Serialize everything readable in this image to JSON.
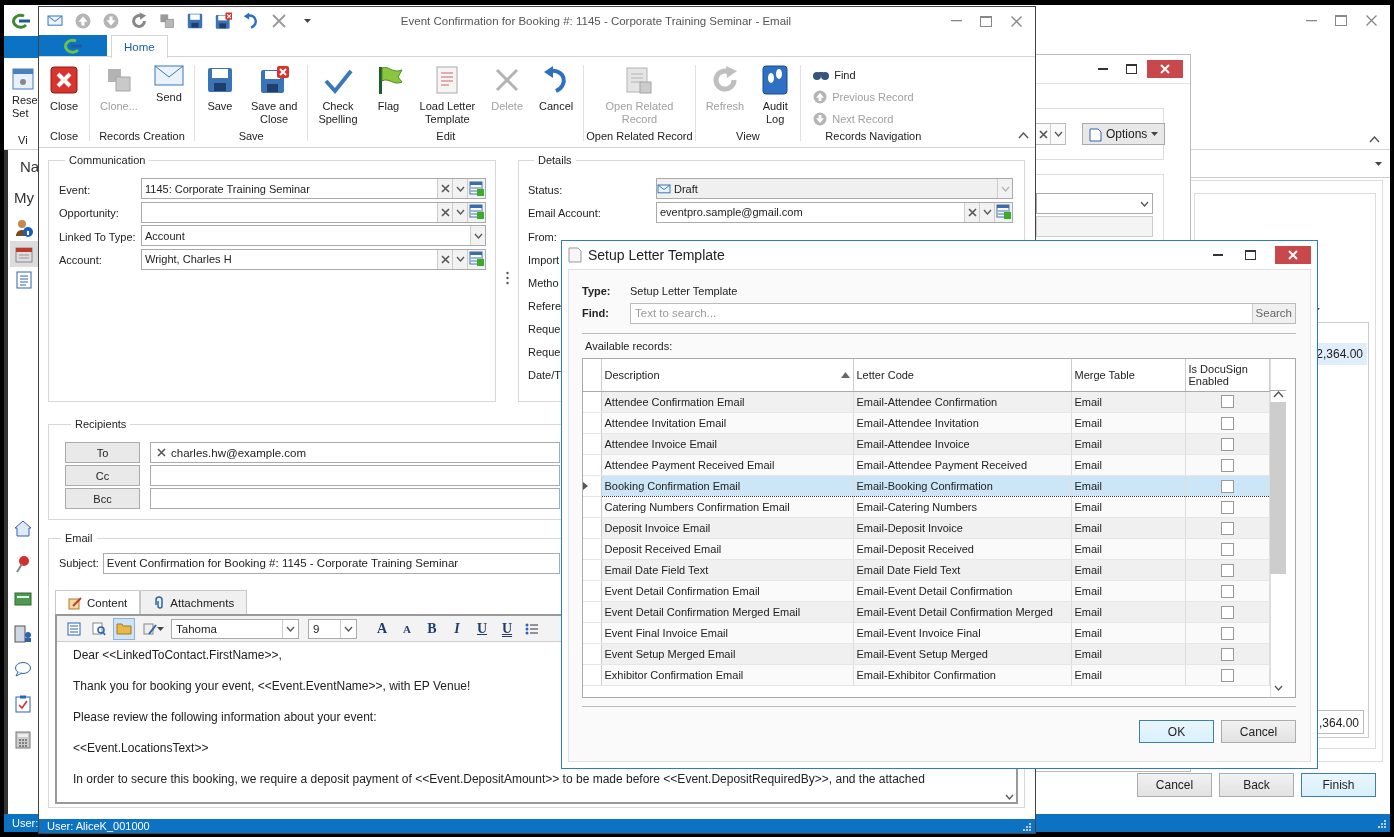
{
  "main_window": {
    "ribbon_button_lines": [
      "Rese",
      "Set"
    ],
    "ribbon_group": "Vi",
    "nav": {
      "title": "Na",
      "subtitle": "My",
      "icons": [
        {
          "selected": false
        },
        {
          "selected": true
        },
        {
          "selected": false
        }
      ]
    },
    "wizard": {
      "amount": "2,364.00",
      "total": ",364.00",
      "buttons": [
        {
          "label": "Cancel",
          "default": false
        },
        {
          "label": "Back",
          "default": false
        },
        {
          "label": "Finish",
          "default": true
        }
      ]
    },
    "status_bar": {
      "user": "User:"
    }
  },
  "options_window": {
    "options_button": "Options"
  },
  "email_window": {
    "title": "Event Confirmation for Booking #: 1145 - Corporate Training Seminar - Email",
    "tab": "Home",
    "ribbon": {
      "groups": [
        {
          "label": "Close",
          "buttons": [
            {
              "label": "Close",
              "disabled": false
            }
          ]
        },
        {
          "label": "Records Creation",
          "buttons": [
            {
              "label": "Clone...",
              "disabled": true
            },
            {
              "label": "Send",
              "disabled": false
            }
          ]
        },
        {
          "label": "Save",
          "buttons": [
            {
              "label": "Save",
              "disabled": false
            },
            {
              "label": "Save and\nClose",
              "disabled": false
            }
          ]
        },
        {
          "label": "Edit",
          "buttons": [
            {
              "label": "Check\nSpelling",
              "disabled": false
            },
            {
              "label": "Flag",
              "disabled": false
            },
            {
              "label": "Load Letter\nTemplate",
              "disabled": false
            },
            {
              "label": "Delete",
              "disabled": true
            },
            {
              "label": "Cancel",
              "disabled": false
            }
          ]
        },
        {
          "label": "Open Related Record",
          "buttons": [
            {
              "label": "Open Related\nRecord",
              "disabled": true
            }
          ]
        },
        {
          "label": "View",
          "buttons": [
            {
              "label": "Refresh",
              "disabled": true
            },
            {
              "label": "Audit\nLog",
              "disabled": false
            }
          ]
        },
        {
          "label": "Records Navigation",
          "small_buttons": [
            {
              "label": "Find",
              "disabled": false
            },
            {
              "label": "Previous Record",
              "disabled": true
            },
            {
              "label": "Next Record",
              "disabled": true
            }
          ]
        }
      ]
    },
    "communication": {
      "legend": "Communication",
      "fields": [
        {
          "label": "Event:",
          "value": "1145: Corporate Training Seminar",
          "kind": "lookup"
        },
        {
          "label": "Opportunity:",
          "kind": "lookup"
        },
        {
          "label": "Linked To Type:",
          "value": "Account",
          "kind": "combo"
        },
        {
          "label": "Account:",
          "value": "Wright, Charles H",
          "kind": "lookup"
        }
      ]
    },
    "details": {
      "legend": "Details",
      "status": {
        "label": "Status:",
        "value": "Draft",
        "disabled": true
      },
      "email_account": {
        "label": "Email Account:",
        "value": "eventpro.sample@gmail.com"
      },
      "labels": [
        "From:",
        "Import",
        "Metho",
        "Refere",
        "Reque",
        "Reque",
        "Date/T"
      ]
    },
    "recipients": {
      "legend": "Recipients",
      "rows": [
        {
          "button": "To",
          "chips": [
            "charles.hw@example.com"
          ]
        },
        {
          "button": "Cc",
          "chips": []
        },
        {
          "button": "Bcc",
          "chips": []
        }
      ]
    },
    "email": {
      "legend": "Email",
      "subject_label": "Subject:",
      "subject": "Event Confirmation for Booking #: 1145 - Corporate Training Seminar",
      "tabs": [
        {
          "label": "Content",
          "selected": true
        },
        {
          "label": "Attachments",
          "selected": false
        }
      ],
      "font": "Tahoma",
      "size": "9",
      "format_buttons": [
        "A",
        "A",
        "B",
        "I",
        "U",
        "U"
      ],
      "body": [
        "Dear <<LinkedToContact.FirstName>>,",
        "Thank you for booking your event, <<Event.EventName>>, with EP Venue!",
        "Please review the following information about your event:",
        "<<Event.LocationsText>>",
        "In order to secure this booking, we require a deposit payment of <<Event.DepositAmount>> to be made before <<Event.DepositRequiredBy>>, and the attached"
      ]
    },
    "status_bar": {
      "user": "User: AliceK_001000"
    }
  },
  "letter_dialog": {
    "title": "Setup Letter Template",
    "type_label": "Type:",
    "type_value": "Setup Letter Template",
    "find_label": "Find:",
    "find_placeholder": "Text to search...",
    "search_button": "Search",
    "available_label": "Available records:",
    "table": {
      "columns": [
        "Description",
        "Letter Code",
        "Merge Table",
        "Is DocuSign Enabled"
      ],
      "rows": [
        {
          "description": "Attendee Confirmation Email",
          "letter_code": "Email-Attendee Confirmation",
          "merge_table": "Email",
          "docusign_enabled": false,
          "selected": false
        },
        {
          "description": "Attendee Invitation Email",
          "letter_code": "Email-Attendee Invitation",
          "merge_table": "Email",
          "docusign_enabled": false,
          "selected": false
        },
        {
          "description": "Attendee Invoice Email",
          "letter_code": "Email-Attendee Invoice",
          "merge_table": "Email",
          "docusign_enabled": false,
          "selected": false
        },
        {
          "description": "Attendee Payment Received Email",
          "letter_code": "Email-Attendee Payment Received",
          "merge_table": "Email",
          "docusign_enabled": false,
          "selected": false
        },
        {
          "description": "Booking Confirmation Email",
          "letter_code": "Email-Booking Confirmation",
          "merge_table": "Email",
          "docusign_enabled": false,
          "selected": true
        },
        {
          "description": "Catering Numbers Confirmation Email",
          "letter_code": "Email-Catering Numbers",
          "merge_table": "Email",
          "docusign_enabled": false,
          "selected": false
        },
        {
          "description": "Deposit Invoice Email",
          "letter_code": "Email-Deposit Invoice",
          "merge_table": "Email",
          "docusign_enabled": false,
          "selected": false
        },
        {
          "description": "Deposit Received Email",
          "letter_code": "Email-Deposit Received",
          "merge_table": "Email",
          "docusign_enabled": false,
          "selected": false
        },
        {
          "description": "Email Date Field Text",
          "letter_code": "Email Date Field Text",
          "merge_table": "Email",
          "docusign_enabled": false,
          "selected": false
        },
        {
          "description": "Event Detail Confirmation Email",
          "letter_code": "Email-Event Detail Confirmation",
          "merge_table": "Email",
          "docusign_enabled": false,
          "selected": false
        },
        {
          "description": "Event Detail Confirmation Merged Email",
          "letter_code": "Email-Event Detail Confirmation Merged",
          "merge_table": "Email",
          "docusign_enabled": false,
          "selected": false
        },
        {
          "description": "Event Final Invoice Email",
          "letter_code": "Email-Event Invoice Final",
          "merge_table": "Email",
          "docusign_enabled": false,
          "selected": false
        },
        {
          "description": "Event Setup Merged Email",
          "letter_code": "Email-Event Setup Merged",
          "merge_table": "Email",
          "docusign_enabled": false,
          "selected": false
        },
        {
          "description": "Exhibitor Confirmation Email",
          "letter_code": "Email-Exhibitor Confirmation",
          "merge_table": "Email",
          "docusign_enabled": false,
          "selected": false
        }
      ]
    },
    "buttons": [
      {
        "label": "OK",
        "default": true
      },
      {
        "label": "Cancel",
        "default": false
      }
    ]
  }
}
